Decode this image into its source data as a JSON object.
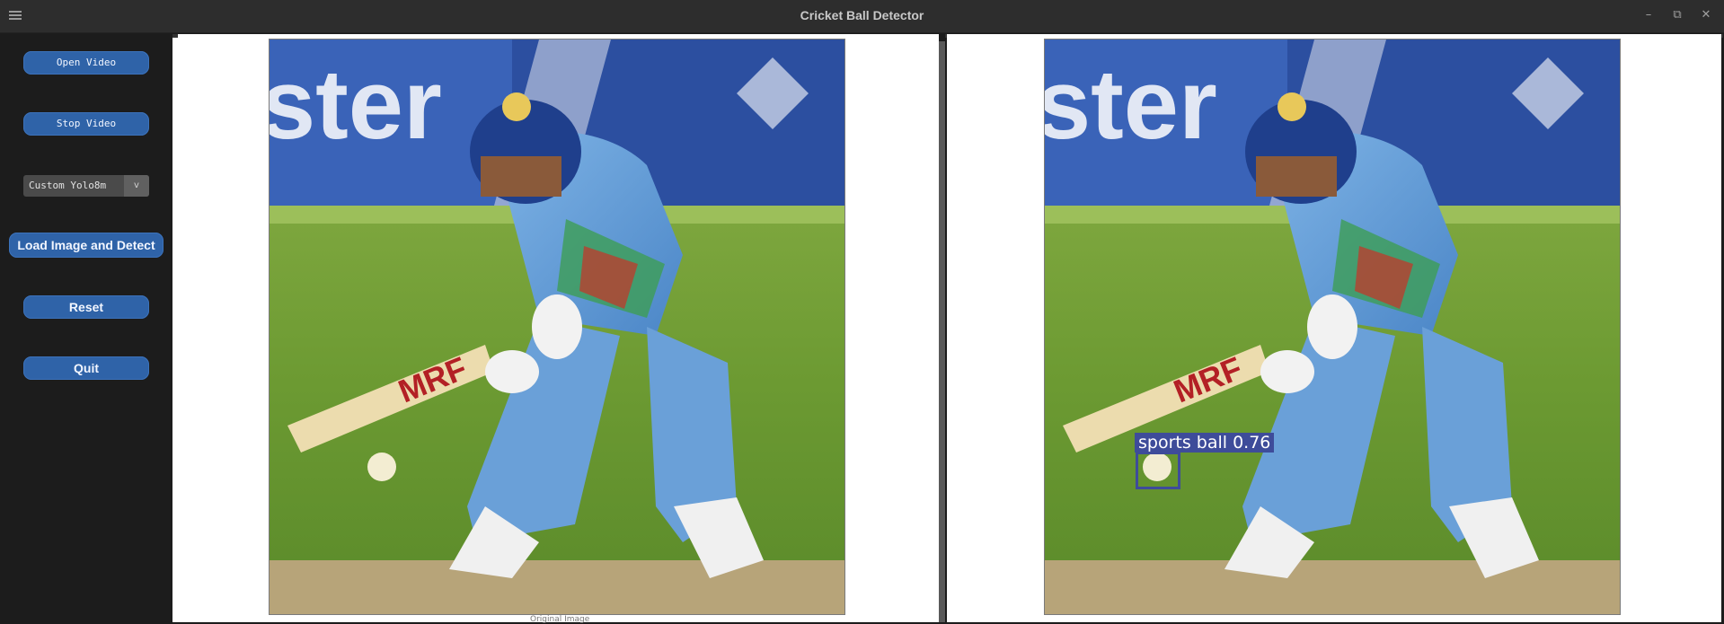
{
  "window": {
    "title": "Cricket Ball Detector",
    "menu_icon": "hamburger-icon",
    "controls": [
      "–",
      "⧉",
      "✕"
    ]
  },
  "sidebar": {
    "open_video": "Open Video",
    "stop_video": "Stop Video",
    "model_select": {
      "selected": "Custom Yolo8m",
      "arrow": "v"
    },
    "load_detect": "Load Image and Detect",
    "reset": "Reset",
    "quit": "Quit"
  },
  "panes": {
    "left": {
      "caption": "Original Image"
    },
    "right": {
      "detection": {
        "label": "sports ball 0.76",
        "class": "sports ball",
        "confidence": 0.76
      }
    }
  },
  "colors": {
    "accent_button": "#2f63a8",
    "detection_box": "#3e4c9a"
  }
}
